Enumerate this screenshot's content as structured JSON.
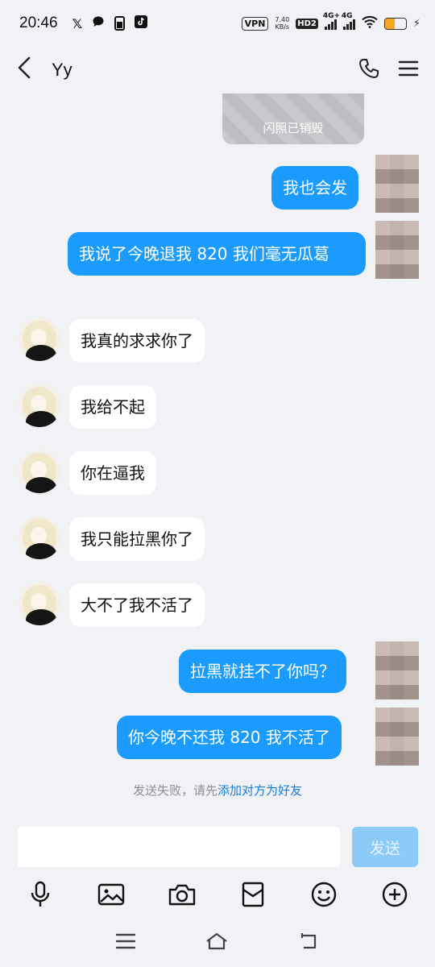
{
  "status_bar": {
    "time": "20:46",
    "left_icons": [
      "x-icon",
      "message-icon",
      "battery-saver-icon",
      "tiktok-icon"
    ],
    "vpn": "VPN",
    "net_speed_value": "7.40",
    "net_speed_unit": "KB/s",
    "hd": "HD2",
    "sim1": "4G+",
    "sim2": "4G",
    "battery_level": 0.45,
    "battery_color": "#f5a623"
  },
  "header": {
    "title": "Yy"
  },
  "flash_notice": "闪照已销毁",
  "messages": [
    {
      "dir": "out",
      "text": "我也会发"
    },
    {
      "dir": "out",
      "text": "我说了今晚退我 820 我们毫无瓜葛"
    },
    {
      "dir": "in",
      "text": "我真的求求你了"
    },
    {
      "dir": "in",
      "text": "我给不起"
    },
    {
      "dir": "in",
      "text": "你在逼我"
    },
    {
      "dir": "in",
      "text": "我只能拉黑你了"
    },
    {
      "dir": "in",
      "text": "大不了我不活了"
    },
    {
      "dir": "out",
      "text": "拉黑就挂不了你吗？"
    },
    {
      "dir": "out",
      "text": "你今晚不还我 820 我不活了"
    }
  ],
  "fail_note": {
    "prefix": "发送失败，请先",
    "link": "添加对方为好友"
  },
  "input": {
    "value": "",
    "send_label": "发送"
  },
  "toolbar": [
    "mic-icon",
    "image-icon",
    "camera-icon",
    "red-packet-icon",
    "emoji-icon",
    "plus-icon"
  ],
  "colors": {
    "outgoing_bubble": "#1a9bfd",
    "background": "#f1f2f6",
    "link": "#1a7cd8"
  }
}
